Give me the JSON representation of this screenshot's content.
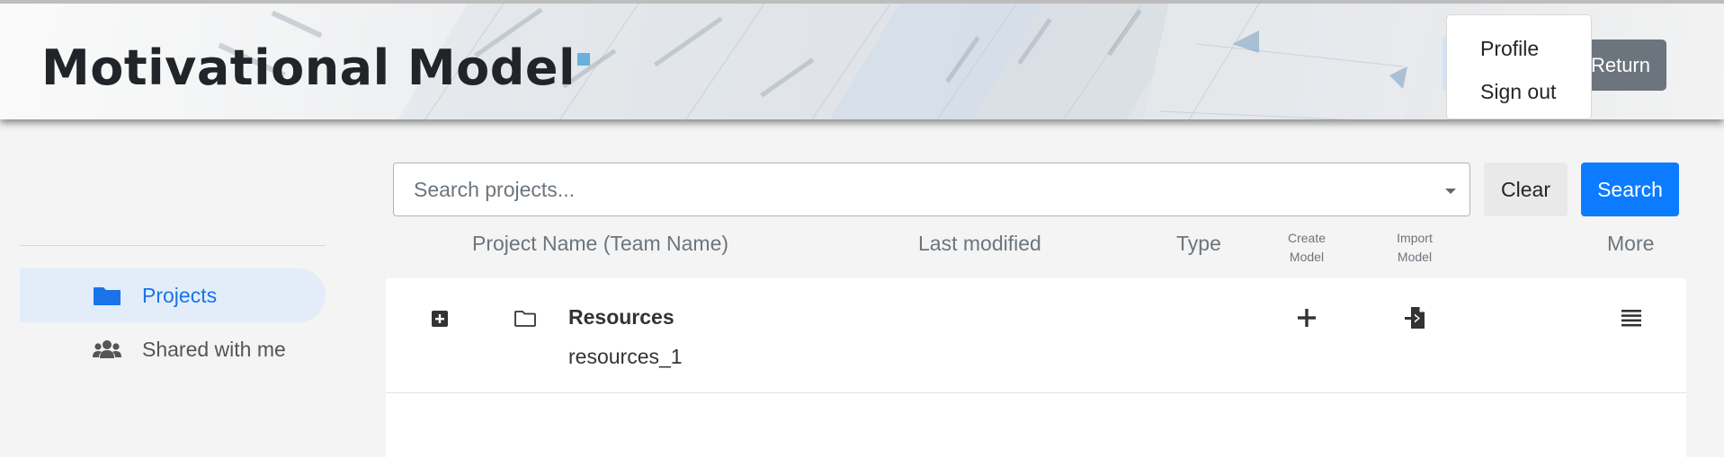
{
  "header": {
    "title": "Motivational Model",
    "return_label": "Return"
  },
  "user_menu": {
    "items": [
      {
        "label": "Profile"
      },
      {
        "label": "Sign out"
      }
    ]
  },
  "sidebar": {
    "items": [
      {
        "label": "Projects",
        "icon": "folder-icon",
        "active": true
      },
      {
        "label": "Shared with me",
        "icon": "users-icon",
        "active": false
      }
    ]
  },
  "search": {
    "placeholder": "Search projects...",
    "value": "",
    "clear_label": "Clear",
    "search_label": "Search"
  },
  "table": {
    "columns": {
      "name": "Project Name (Team Name)",
      "modified": "Last modified",
      "type": "Type",
      "create_line1": "Create",
      "create_line2": "Model",
      "import_line1": "Import",
      "import_line2": "Model",
      "more": "More"
    },
    "rows": [
      {
        "name": "Resources",
        "sub": "resources_1",
        "icons": [
          "expand-plus-icon",
          "folder-outline-icon",
          "plus-icon",
          "file-import-icon",
          "menu-lines-icon"
        ]
      }
    ]
  },
  "colors": {
    "accent": "#0d7bff",
    "active_bg": "#e3edf9",
    "active_text": "#1a73e8",
    "return_btn": "#6c757d",
    "title": "#212529"
  }
}
